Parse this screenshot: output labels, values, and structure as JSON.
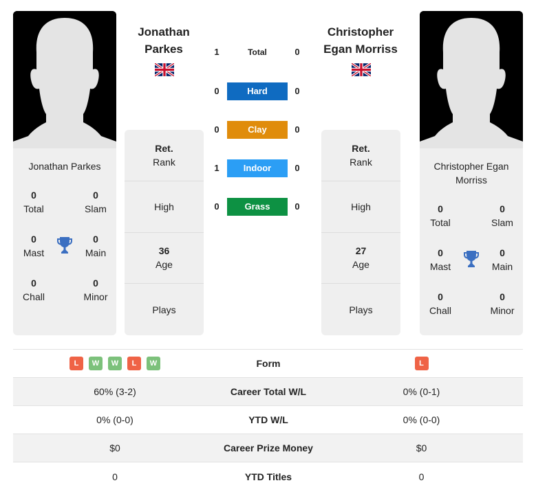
{
  "colors": {
    "hard": "#0f6bc1",
    "clay": "#e08c0b",
    "indoor": "#2b9ef5",
    "grass": "#0d9143",
    "win": "#7cc17b",
    "loss": "#ef6346",
    "trophy": "#3b6fc1"
  },
  "player_left": {
    "name_line1": "Jonathan",
    "name_line2": "Parkes",
    "full_name": "Jonathan Parkes",
    "flag": "uk-flag",
    "titles": {
      "total": "0",
      "total_label": "Total",
      "slam": "0",
      "slam_label": "Slam",
      "mast": "0",
      "mast_label": "Mast",
      "main": "0",
      "main_label": "Main",
      "chall": "0",
      "chall_label": "Chall",
      "minor": "0",
      "minor_label": "Minor"
    },
    "info": {
      "rank_value": "Ret.",
      "rank_label": "Rank",
      "high_label": "High",
      "age_value": "36",
      "age_label": "Age",
      "plays_label": "Plays"
    }
  },
  "player_right": {
    "name_line1": "Christopher",
    "name_line2": "Egan Morriss",
    "full_name": "Christopher Egan Morriss",
    "flag": "uk-flag",
    "titles": {
      "total": "0",
      "total_label": "Total",
      "slam": "0",
      "slam_label": "Slam",
      "mast": "0",
      "mast_label": "Mast",
      "main": "0",
      "main_label": "Main",
      "chall": "0",
      "chall_label": "Chall",
      "minor": "0",
      "minor_label": "Minor"
    },
    "info": {
      "rank_value": "Ret.",
      "rank_label": "Rank",
      "high_label": "High",
      "age_value": "27",
      "age_label": "Age",
      "plays_label": "Plays"
    }
  },
  "h2h": [
    {
      "label": "Total",
      "left": "1",
      "right": "0",
      "kind": "total"
    },
    {
      "label": "Hard",
      "left": "0",
      "right": "0",
      "kind": "hard"
    },
    {
      "label": "Clay",
      "left": "0",
      "right": "0",
      "kind": "clay"
    },
    {
      "label": "Indoor",
      "left": "1",
      "right": "0",
      "kind": "indoor"
    },
    {
      "label": "Grass",
      "left": "0",
      "right": "0",
      "kind": "grass"
    }
  ],
  "comparison": {
    "form_label": "Form",
    "form_left": [
      "L",
      "W",
      "W",
      "L",
      "W"
    ],
    "form_right": [
      "L"
    ],
    "rows": [
      {
        "label": "Career Total W/L",
        "left": "60% (3-2)",
        "right": "0% (0-1)"
      },
      {
        "label": "YTD W/L",
        "left": "0% (0-0)",
        "right": "0% (0-0)"
      },
      {
        "label": "Career Prize Money",
        "left": "$0",
        "right": "$0"
      },
      {
        "label": "YTD Titles",
        "left": "0",
        "right": "0"
      }
    ]
  }
}
